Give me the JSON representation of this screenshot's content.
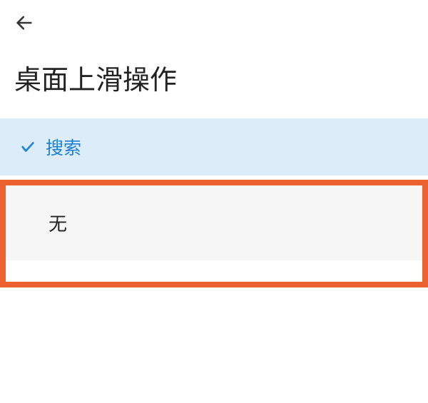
{
  "header": {
    "title": "桌面上滑操作"
  },
  "options": {
    "selected": {
      "label": "搜索"
    },
    "unselected": {
      "label": "无"
    }
  }
}
